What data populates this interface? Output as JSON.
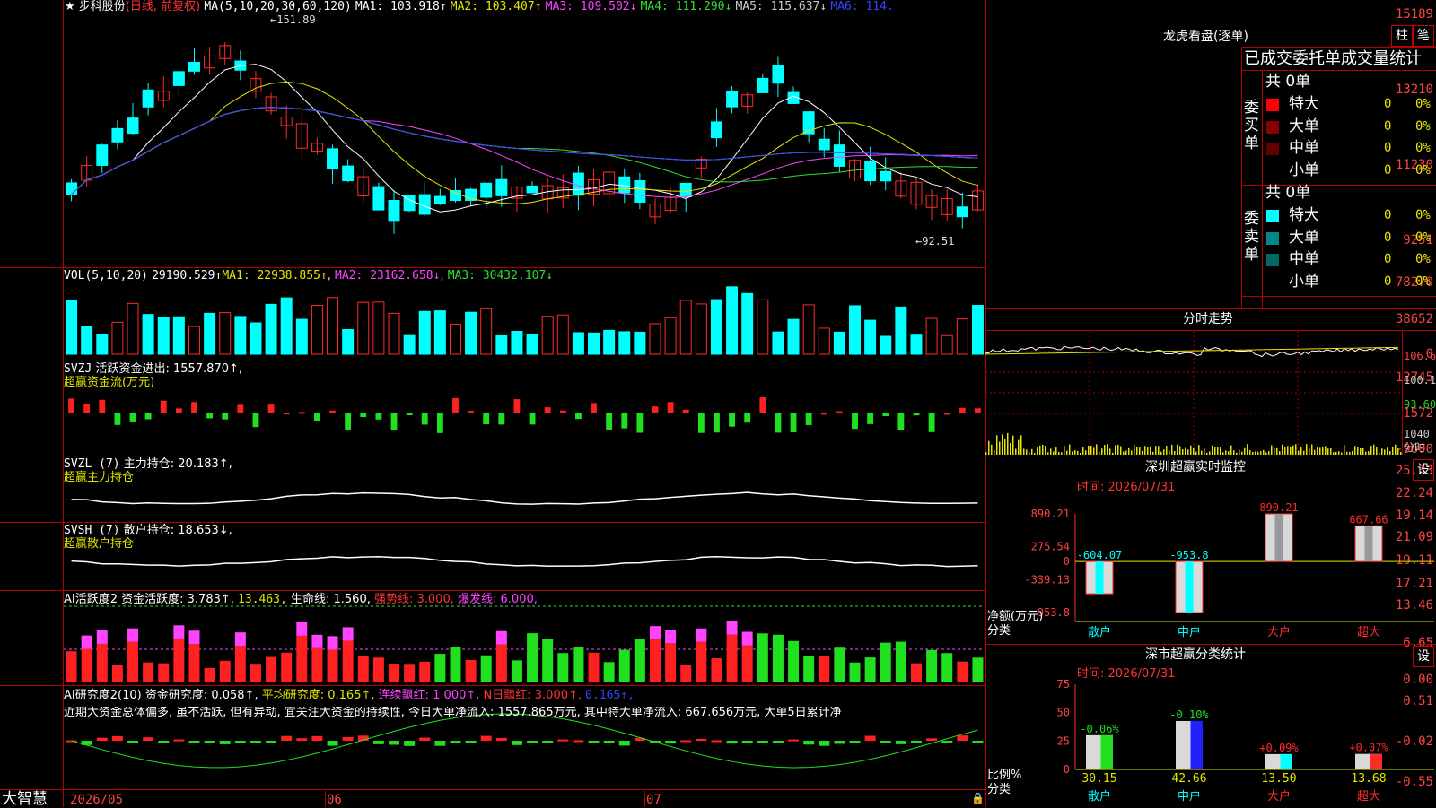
{
  "app": {
    "logo": "大智慧"
  },
  "kline": {
    "name": "步科股份",
    "mode": "(日线, 前复权)",
    "ma_label": "MA(5,10,20,30,60,120)",
    "ma": [
      {
        "label": "MA1: 103.918↑",
        "color": "#ffffff"
      },
      {
        "label": "MA2: 103.407↑",
        "color": "#e5e500"
      },
      {
        "label": "MA3: 109.502↓",
        "color": "#ff44ff"
      },
      {
        "label": "MA4: 111.290↓",
        "color": "#33dd33"
      },
      {
        "label": "MA5: 115.637↓",
        "color": "#cccccc"
      },
      {
        "label": "MA6: 114.",
        "color": "#3344ff"
      }
    ],
    "high_label": "←151.89",
    "low_label": "←92.51",
    "y_ticks": [
      "15189",
      "13210",
      "11230",
      "9251"
    ]
  },
  "volume": {
    "title": "VOL(5,10,20)",
    "value": "29190.529↑",
    "ma": [
      {
        "label": "MA1: 22938.855↑",
        "color": "#e5e500"
      },
      {
        "label": "MA2: 23162.658↓",
        "color": "#ff44ff"
      },
      {
        "label": "MA3: 30432.107↓",
        "color": "#33dd33"
      }
    ],
    "y_ticks": [
      "78270",
      "38652",
      "0"
    ]
  },
  "svzj": {
    "title": "SVZJ",
    "label": "活跃资金进出: 1557.870↑,",
    "sub": "超赢资金流(万元)",
    "y_ticks": [
      "12745",
      "1572",
      "-9600"
    ]
  },
  "svzl": {
    "title": "SVZL (7)",
    "label": "主力持仓: 20.183↑,",
    "sub": "超赢主力持仓",
    "y_ticks": [
      "25.33",
      "22.24",
      "19.14"
    ]
  },
  "svsh": {
    "title": "SVSH (7)",
    "label": "散户持仓: 18.653↓,",
    "sub": "超赢散户持仓",
    "y_ticks": [
      "21.09",
      "19.11",
      "17.21"
    ]
  },
  "ai_active": {
    "title": "AI活跃度2",
    "a": "资金活跃度: 3.783↑,",
    "b": "13.463,",
    "c": "生命线: 1.560,",
    "d": "强势线: 3.000,",
    "e": "爆发线: 6.000,",
    "y_ticks": [
      "13.46",
      "6.65",
      "0.00"
    ]
  },
  "ai_research": {
    "title": "AI研究度2(10)",
    "a": "资金研究度: 0.058↑,",
    "b": "平均研究度: 0.165↑,",
    "c": "连续飘红: 1.000↑,",
    "d": "N日飘红: 3.000↑,",
    "e": "0.165↑,",
    "comment": "近期大资金总体偏多, 虽不活跃, 但有异动, 宜关注大资金的持续性, 今日大单净流入: 1557.865万元, 其中特大单净流入: 667.656万元, 大单5日累计净",
    "y_ticks": [
      "0.51",
      "-0.02",
      "-0.55"
    ]
  },
  "xaxis": [
    "2026/05",
    "06",
    "07"
  ],
  "lhb": {
    "title": "龙虎看盘(逐单)",
    "btn1": "柱",
    "btn2": "笔",
    "header": "已成交委托单成交量统计",
    "buy_label": "委买单",
    "sell_label": "委卖单",
    "buy_total": "共 0单",
    "sell_total": "共 0单",
    "buy_rows": [
      {
        "name": "特大",
        "count": "0",
        "pct": "0%",
        "color": "#ff0000"
      },
      {
        "name": "大单",
        "count": "0",
        "pct": "0%",
        "color": "#880000"
      },
      {
        "name": "中单",
        "count": "0",
        "pct": "0%",
        "color": "#660000"
      },
      {
        "name": "小单",
        "count": "0",
        "pct": "0%",
        "color": ""
      }
    ],
    "sell_rows": [
      {
        "name": "特大",
        "count": "0",
        "pct": "0%",
        "color": "#00ffff"
      },
      {
        "name": "大单",
        "count": "0",
        "pct": "0%",
        "color": "#008888"
      },
      {
        "name": "中单",
        "count": "0",
        "pct": "0%",
        "color": "#006666"
      },
      {
        "name": "小单",
        "count": "0",
        "pct": "0%",
        "color": ""
      }
    ]
  },
  "intraday": {
    "title": "分时走势",
    "y_ticks": [
      "106.6",
      "100.1",
      "93.60",
      "1040",
      "分时"
    ]
  },
  "monitor": {
    "title": "深圳超赢实时监控",
    "btn": "设",
    "date": "时间: 2026/07/31",
    "y_ticks": [
      "890.21",
      "275.54",
      "0",
      "-339.13",
      "-953.8"
    ],
    "ylabel1": "净额(万元)",
    "ylabel2": "分类",
    "cats": [
      "散户",
      "中户",
      "大户",
      "超大"
    ],
    "values": [
      -604.07,
      -953.8,
      890.21,
      667.66
    ],
    "labels": [
      "-604.07",
      "-953.8",
      "890.21",
      "667.66"
    ]
  },
  "classify": {
    "title": "深市超赢分类统计",
    "btn": "设",
    "date": "时间: 2026/07/31",
    "y_ticks": [
      "75",
      "50",
      "25",
      "0"
    ],
    "ylabel1": "比例%",
    "ylabel2": "分类",
    "cats": [
      "散户",
      "中户",
      "大户",
      "超大"
    ],
    "values": [
      30.15,
      42.66,
      13.5,
      13.68
    ],
    "values_text": [
      "30.15",
      "42.66",
      "13.50",
      "13.68"
    ],
    "changes": [
      "-0.06%",
      "-0.10%",
      "+0.09%",
      "+0.07%"
    ]
  },
  "chart_data": [
    {
      "type": "bar",
      "title": "深圳超赢实时监控",
      "categories": [
        "散户",
        "中户",
        "大户",
        "超大"
      ],
      "values": [
        -604.07,
        -953.8,
        890.21,
        667.66
      ],
      "ylabel": "净额(万元)",
      "xlabel": "分类",
      "ylim": [
        -953.8,
        890.21
      ]
    },
    {
      "type": "bar",
      "title": "深市超赢分类统计",
      "categories": [
        "散户",
        "中户",
        "大户",
        "超大"
      ],
      "values": [
        30.15,
        42.66,
        13.5,
        13.68
      ],
      "ylabel": "比例%",
      "xlabel": "分类",
      "ylim": [
        0,
        75
      ]
    }
  ]
}
